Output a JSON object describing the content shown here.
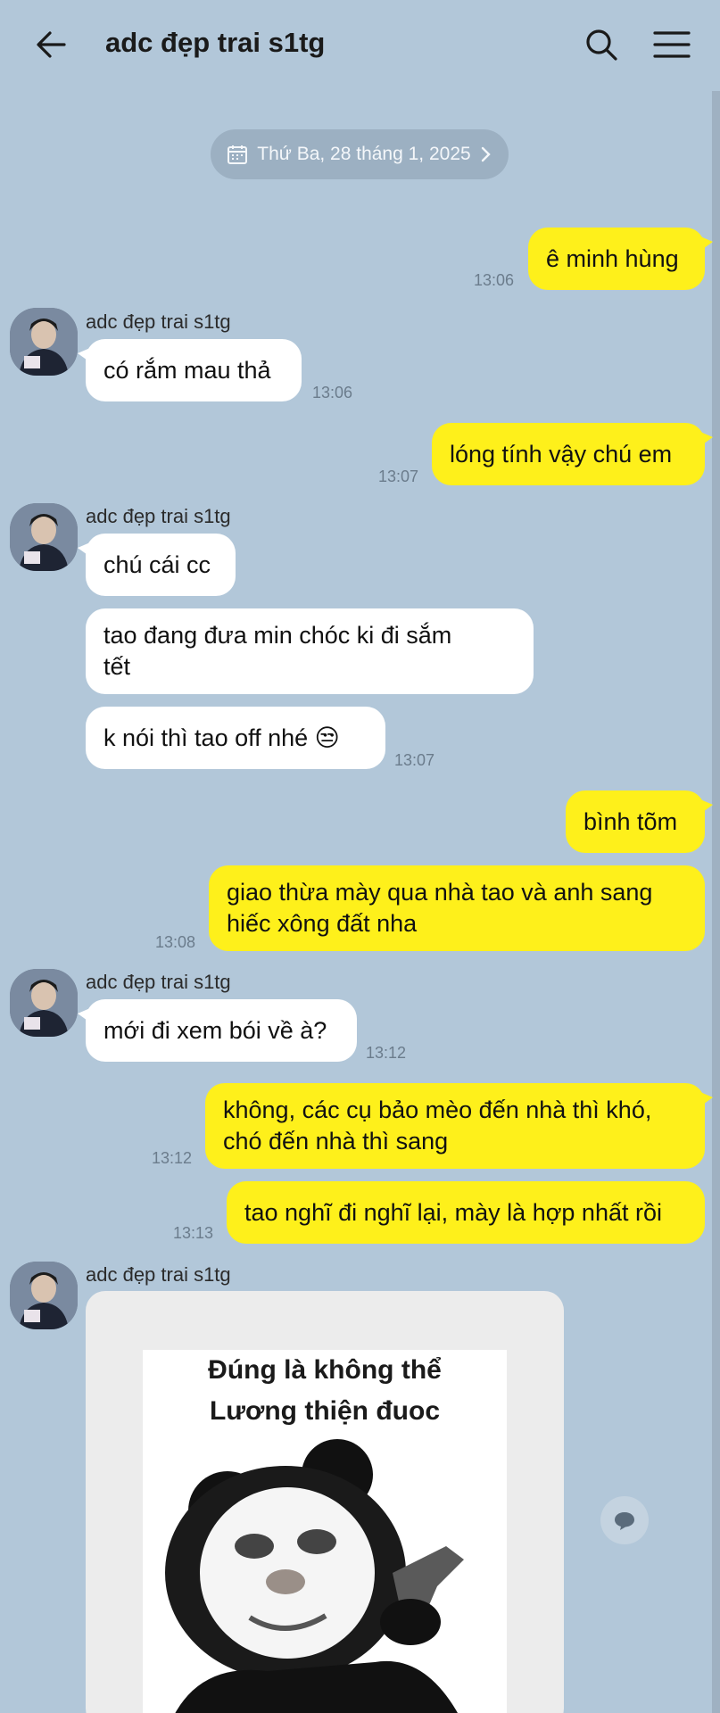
{
  "header": {
    "title": "adc đẹp trai s1tg",
    "back_icon": "arrow-left-icon",
    "search_icon": "search-icon",
    "menu_icon": "hamburger-menu-icon"
  },
  "date_divider": {
    "label": "Thứ Ba, 28 tháng 1, 2025",
    "icon": "calendar-icon",
    "chevron_icon": "chevron-right-icon"
  },
  "contact": {
    "name": "adc đẹp trai s1tg"
  },
  "colors": {
    "background": "#b2c7d9",
    "outgoing_bubble": "#fef01b",
    "incoming_bubble": "#ffffff"
  },
  "messages": {
    "m1": {
      "text": "ê minh hùng",
      "time": "13:06"
    },
    "m2": {
      "text": "có rắm mau thả",
      "time": "13:06"
    },
    "m3": {
      "text": "lóng tính vậy chú em",
      "time": "13:07"
    },
    "m4": {
      "text": "chú cái cc"
    },
    "m5": {
      "line1": "tao đang đưa min chóc ki đi sắm",
      "line2": "tết"
    },
    "m6": {
      "text": "k nói thì tao off nhé 😒",
      "time": "13:07"
    },
    "m7": {
      "text": "bình tõm"
    },
    "m8": {
      "line1": "giao thừa mày qua nhà tao và anh sang",
      "line2": "hiếc xông đất nha",
      "time": "13:08"
    },
    "m9": {
      "text": "mới đi xem bói về à?",
      "time": "13:12"
    },
    "m10": {
      "line1": "không, các cụ bảo mèo đến nhà thì khó,",
      "line2": "chó đến nhà thì sang",
      "time": "13:12"
    },
    "m11": {
      "text": "tao nghĩ đi nghĩ lại, mày là hợp nhất rồi",
      "time": "13:13"
    },
    "m12": {
      "meme_line1": "Đúng là không thể",
      "meme_line2": "Lương thiện đuoc"
    }
  },
  "reply_icon": "chat-bubble-icon"
}
